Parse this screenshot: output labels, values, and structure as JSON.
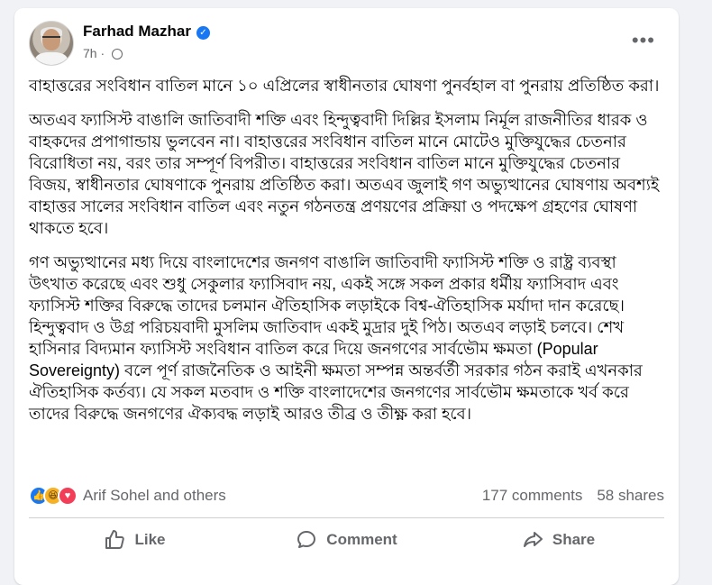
{
  "post": {
    "author": "Farhad Mazhar",
    "time": "7h",
    "more_label": "•••",
    "paragraphs": [
      "বাহাত্তরের সংবিধান বাতিল মানে ১০ এপ্রিলের স্বাধীনতার ঘোষণা পুনর্বহাল বা  পুনরায় প্রতিষ্ঠিত করা।",
      "অতএব ফ্যাসিস্ট বাঙালি জাতিবাদী শক্তি এবং হিন্দুত্ববাদী দিল্লির ইসলাম নির্মূল রাজনীতির ধারক ও বাহকদের প্রপাগান্ডায় ভুলবেন না। বাহাত্তরের সংবিধান বাতিল মানে মোটেও মুক্তিযুদ্ধের চেতনার বিরোধিতা নয়, বরং তার সম্পূর্ণ বিপরীত। বাহাত্তরের সংবিধান বাতিল মানে মুক্তিযুদ্ধের চেতনার বিজয়, স্বাধীনতার ঘোষণাকে  পুনরায় প্রতিষ্ঠিত করা। অতএব জুলাই গণ অভ্যুত্থানের ঘোষণায় অবশ্যই বাহাত্তর সালের সংবিধান বাতিল এবং নতুন গঠনতন্ত্র প্রণয়ণের প্রক্রিয়া ও পদক্ষেপ গ্রহণের ঘোষণা থাকতে হবে।",
      "গণ অভ্যুত্থানের মধ্য দিয়ে বাংলাদেশের জনগণ বাঙালি জাতিবাদী ফ্যাসিস্ট শক্তি ও রাষ্ট্র ব্যবস্থা উৎখাত করেছে এবং  শুধু সেকুলার ফ্যাসিবাদ নয়, একই সঙ্গে সকল প্রকার ধর্মীয় ফ্যাসিবাদ এবং ফ্যাসিস্ট শক্তির বিরুদ্ধে তাদের চলমান ঐতিহাসিক লড়াইকে বিশ্ব-ঐতিহাসিক মর্যাদা দান করেছে। হিন্দুত্ববাদ ও উগ্র পরিচয়বাদী মুসলিম জাতিবাদ একই মুদ্রার দুই পিঠ। অতএব লড়াই চলবে। শেখ হাসিনার বিদ্যমান ফ্যাসিস্ট সংবিধান বাতিল করে দিয়ে জনগণের সার্বভৌম ক্ষমতা (Popular Sovereignty) বলে পূর্ণ রাজনৈতিক  ও আইনী ক্ষমতা সম্পন্ন অন্তর্বর্তী সরকার গঠন করাই এখনকার ঐতিহাসিক কর্তব্য।  যে সকল মতবাদ ও শক্তি বাংলাদেশের জনগণের সার্বভৌম ক্ষমতাকে খর্ব করে তাদের বিরুদ্ধে জনগণের ঐক্যবদ্ধ লড়াই আরও তীব্র ও তীক্ষ্ণ করা হবে।"
    ]
  },
  "reactions": {
    "icons": [
      "like-icon",
      "haha-icon",
      "love-icon"
    ],
    "names": "Arif Sohel and others",
    "comments": "177 comments",
    "shares": "58 shares"
  },
  "actions": {
    "like": "Like",
    "comment": "Comment",
    "share": "Share"
  },
  "colors": {
    "background": "#f0f2f5",
    "card": "#ffffff",
    "accent": "#1877f2",
    "muted_text": "#65676b",
    "text": "#050505"
  }
}
